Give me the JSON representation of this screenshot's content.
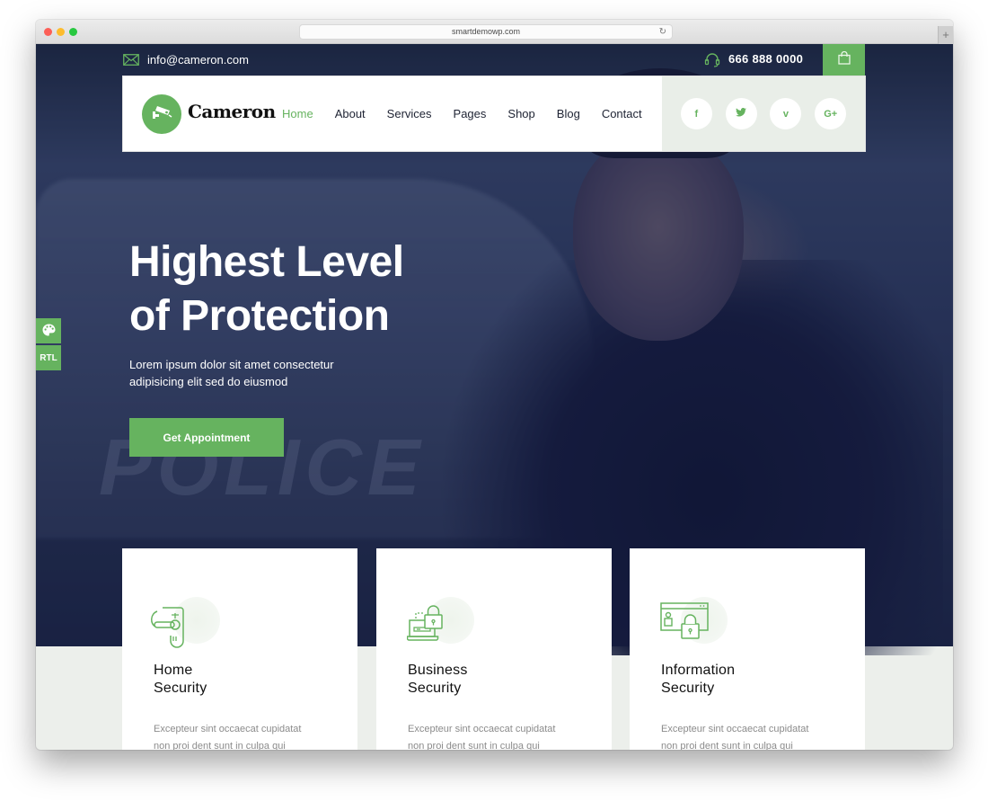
{
  "browser": {
    "url": "smartdemowp.com",
    "reload_icon": "reload-icon",
    "new_tab_label": "+"
  },
  "topbar": {
    "email": "info@cameron.com",
    "phone": "666 888 0000",
    "mail_icon": "envelope-icon",
    "phone_icon": "headset-icon",
    "cart_icon": "shopping-bag-icon"
  },
  "brand": {
    "name": "Cameron",
    "logo_icon": "security-camera-icon"
  },
  "nav": {
    "items": [
      {
        "label": "Home",
        "active": true
      },
      {
        "label": "About",
        "active": false
      },
      {
        "label": "Services",
        "active": false
      },
      {
        "label": "Pages",
        "active": false
      },
      {
        "label": "Shop",
        "active": false
      },
      {
        "label": "Blog",
        "active": false
      },
      {
        "label": "Contact",
        "active": false
      }
    ]
  },
  "social": [
    {
      "name": "facebook",
      "glyph": "f"
    },
    {
      "name": "twitter",
      "glyph": "t"
    },
    {
      "name": "vimeo",
      "glyph": "v"
    },
    {
      "name": "google-plus",
      "glyph": "G+"
    }
  ],
  "side_tabs": {
    "palette_icon": "palette-icon",
    "rtl_label": "RTL"
  },
  "hero": {
    "title_line1": "Highest Level",
    "title_line2": "of Protection",
    "subtitle_line1": "Lorem ipsum dolor sit amet consectetur",
    "subtitle_line2": "adipisicing elit sed do eiusmod",
    "cta_label": "Get Appointment",
    "background_word": "POLICE"
  },
  "services": [
    {
      "title_line1": "Home",
      "title_line2": "Security",
      "icon": "door-lock-icon",
      "desc_line1": "Excepteur sint occaecat cupidatat",
      "desc_line2": "non proi dent sunt in culpa qui"
    },
    {
      "title_line1": "Business",
      "title_line2": "Security",
      "icon": "laptop-lock-icon",
      "desc_line1": "Excepteur sint occaecat cupidatat",
      "desc_line2": "non proi dent sunt in culpa qui"
    },
    {
      "title_line1": "Information",
      "title_line2": "Security",
      "icon": "browser-lock-icon",
      "desc_line1": "Excepteur sint occaecat cupidatat",
      "desc_line2": "non proi dent sunt in culpa qui"
    }
  ],
  "colors": {
    "accent": "#66b35f",
    "dark_text": "#1e2333",
    "muted_text": "#8b8b8b",
    "light_bg": "#e9eee8"
  }
}
